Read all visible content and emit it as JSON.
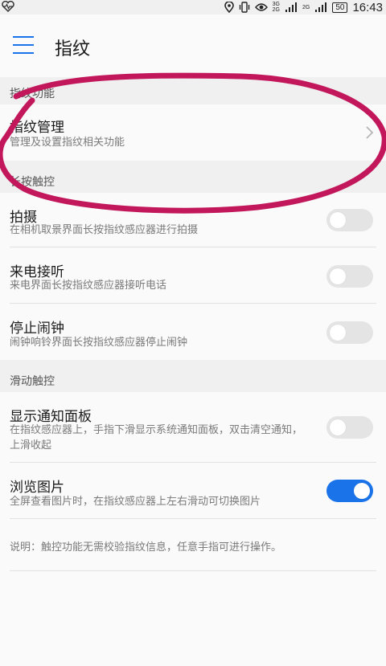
{
  "status_bar": {
    "time": "16:43",
    "battery": "50",
    "net_top": "3G",
    "net_bottom": "2G",
    "net2": "2G",
    "icons": [
      "heart-pulse-icon",
      "location-icon",
      "vibrate-icon",
      "eye-icon",
      "signal-icon"
    ]
  },
  "app_bar": {
    "title": "指纹",
    "menu_icon": "hamburger-icon"
  },
  "sections": [
    {
      "header": "指纹功能",
      "items": [
        {
          "title": "指纹管理",
          "subtitle": "管理及设置指纹相关功能",
          "control": "chevron"
        }
      ]
    },
    {
      "header": "长按触控",
      "items": [
        {
          "title": "拍摄",
          "subtitle": "在相机取景界面长按指纹感应器进行拍摄",
          "control": "toggle",
          "on": false
        },
        {
          "title": "来电接听",
          "subtitle": "来电界面长按指纹感应器接听电话",
          "control": "toggle",
          "on": false
        },
        {
          "title": "停止闹钟",
          "subtitle": "闹钟响铃界面长按指纹感应器停止闹钟",
          "control": "toggle",
          "on": false
        }
      ]
    },
    {
      "header": "滑动触控",
      "items": [
        {
          "title": "显示通知面板",
          "subtitle": "在指纹感应器上，手指下滑显示系统通知面板，双击清空通知，上滑收起",
          "control": "toggle",
          "on": false
        },
        {
          "title": "浏览图片",
          "subtitle": "全屏查看图片时，在指纹感应器上左右滑动可切换图片",
          "control": "toggle",
          "on": true
        }
      ]
    }
  ],
  "note": "说明：触控功能无需校验指纹信息，任意手指可进行操作。",
  "colors": {
    "accent": "#1a73e8",
    "annotation": "#c2185b",
    "toggle_off": "#e4e4e4"
  }
}
